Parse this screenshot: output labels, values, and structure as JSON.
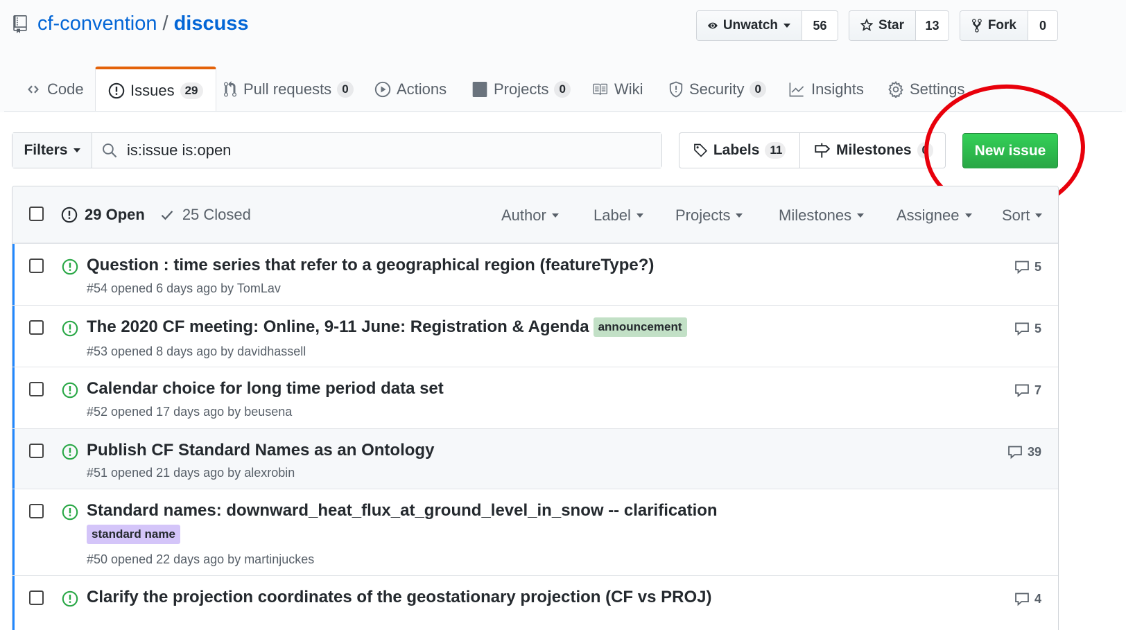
{
  "repo": {
    "owner": "cf-convention",
    "separator": "/",
    "name": "discuss"
  },
  "actions": {
    "watch": {
      "label": "Unwatch",
      "count": "56"
    },
    "star": {
      "label": "Star",
      "count": "13"
    },
    "fork": {
      "label": "Fork",
      "count": "0"
    }
  },
  "tabs": [
    {
      "label": "Code",
      "icon": "code-icon"
    },
    {
      "label": "Issues",
      "counter": "29",
      "icon": "issue-opened-icon",
      "selected": true
    },
    {
      "label": "Pull requests",
      "counter": "0",
      "icon": "git-pull-request-icon"
    },
    {
      "label": "Actions",
      "icon": "play-icon"
    },
    {
      "label": "Projects",
      "counter": "0",
      "icon": "project-icon"
    },
    {
      "label": "Wiki",
      "icon": "book-icon"
    },
    {
      "label": "Security",
      "counter": "0",
      "icon": "shield-icon"
    },
    {
      "label": "Insights",
      "icon": "graph-icon"
    },
    {
      "label": "Settings",
      "icon": "gear-icon"
    }
  ],
  "subnav": {
    "filters_label": "Filters",
    "search_value": "is:issue is:open",
    "labels_label": "Labels",
    "labels_count": "11",
    "milestones_label": "Milestones",
    "milestones_count": "0",
    "new_issue_label": "New issue"
  },
  "list_header": {
    "open_label": "29 Open",
    "closed_label": "25 Closed",
    "filters": [
      "Author",
      "Label",
      "Projects",
      "Milestones",
      "Assignee",
      "Sort"
    ]
  },
  "issues": [
    {
      "title": "Question : time series that refer to a geographical region (featureType?)",
      "meta": "#54 opened 6 days ago by TomLav",
      "comments": "5",
      "labels": []
    },
    {
      "title": "The 2020 CF meeting: Online, 9-11 June: Registration & Agenda",
      "meta": "#53 opened 8 days ago by davidhassell",
      "comments": "5",
      "labels": [
        "announcement"
      ]
    },
    {
      "title": "Calendar choice for long time period data set",
      "meta": "#52 opened 17 days ago by beusena",
      "comments": "7",
      "labels": []
    },
    {
      "title": "Publish CF Standard Names as an Ontology",
      "meta": "#51 opened 21 days ago by alexrobin",
      "comments": "39",
      "labels": []
    },
    {
      "title": "Standard names: downward_heat_flux_at_ground_level_in_snow -- clarification",
      "meta": "#50 opened 22 days ago by martinjuckes",
      "comments": "",
      "labels": [
        "standard name"
      ]
    },
    {
      "title": "Clarify the projection coordinates of the geostationary projection (CF vs PROJ)",
      "meta": "",
      "comments": "4",
      "labels": []
    }
  ],
  "colors": {
    "link": "#0366d6",
    "open_green": "#28a745",
    "tab_accent": "#e36209",
    "annotation_red": "#e8000b",
    "unread_bar": "#2188ff"
  }
}
